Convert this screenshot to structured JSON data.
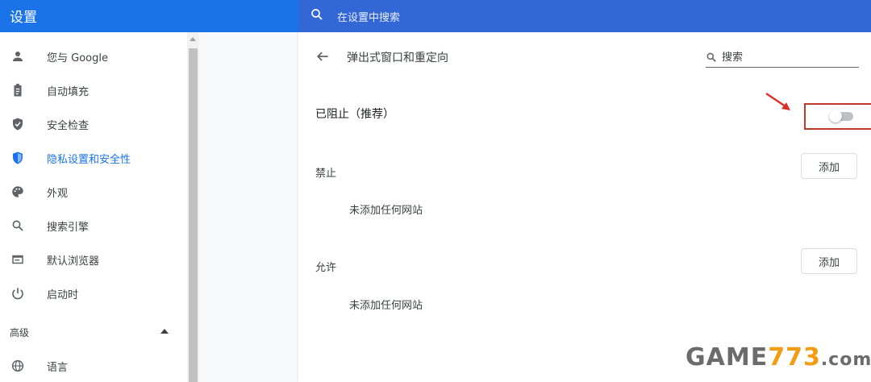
{
  "header": {
    "title": "设置",
    "search_placeholder": "在设置中搜索",
    "colors": {
      "left": "#1a73e8",
      "right": "#3367d6"
    }
  },
  "sidebar": {
    "items": [
      {
        "label": "您与 Google",
        "icon": "person-icon"
      },
      {
        "label": "自动填充",
        "icon": "clipboard-icon"
      },
      {
        "label": "安全检查",
        "icon": "shield-check-icon"
      },
      {
        "label": "隐私设置和安全性",
        "icon": "shield-icon",
        "active": true
      },
      {
        "label": "外观",
        "icon": "palette-icon"
      },
      {
        "label": "搜索引擎",
        "icon": "search-icon"
      },
      {
        "label": "默认浏览器",
        "icon": "browser-icon"
      },
      {
        "label": "启动时",
        "icon": "power-icon"
      }
    ],
    "advanced_label": "高级",
    "language_item": {
      "label": "语言",
      "icon": "globe-icon"
    }
  },
  "panel": {
    "title": "弹出式窗口和重定向",
    "search_placeholder": "搜索",
    "blocked_label": "已阻止（推荐）",
    "toggle_on": false,
    "block_section": {
      "label": "禁止",
      "add_label": "添加",
      "empty_text": "未添加任何网站"
    },
    "allow_section": {
      "label": "允许",
      "add_label": "添加",
      "empty_text": "未添加任何网站"
    }
  },
  "watermark": {
    "game": "GAME",
    "num": "773",
    "com": ".com"
  }
}
